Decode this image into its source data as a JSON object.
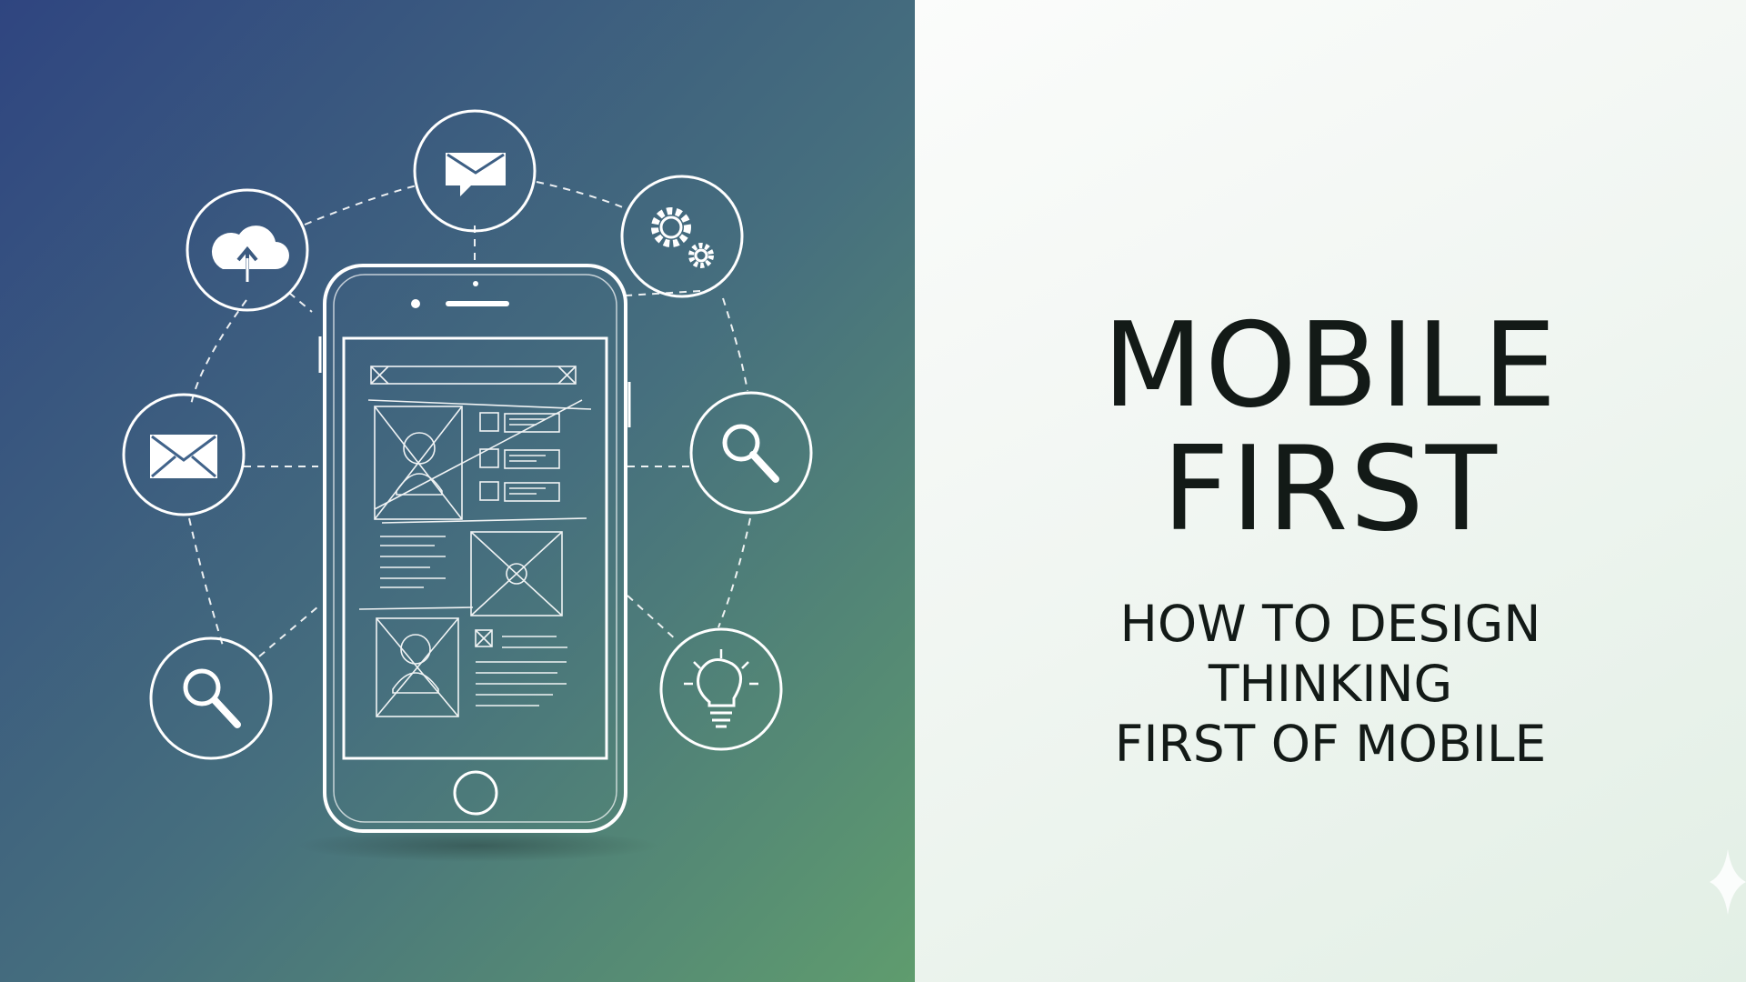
{
  "title": {
    "line1": "MOBILE",
    "line2": "FIRST"
  },
  "subtitle": {
    "line1": "HOW TO DESIGN",
    "line2": "THINKING",
    "line3": "FIRST OF MOBILE"
  },
  "colors": {
    "left_gradient_top": "#2f4580",
    "left_gradient_bottom": "#5e9a6e",
    "right_background": "#f1f6f2",
    "text": "#131a17",
    "line_art": "#ffffff"
  },
  "icons": [
    "cloud-icon",
    "email-bubble-icon",
    "gears-icon",
    "envelope-icon",
    "magnifier-icon",
    "magnifier-icon-left",
    "lightbulb-icon",
    "smartphone-wireframe",
    "sparkle-icon"
  ]
}
